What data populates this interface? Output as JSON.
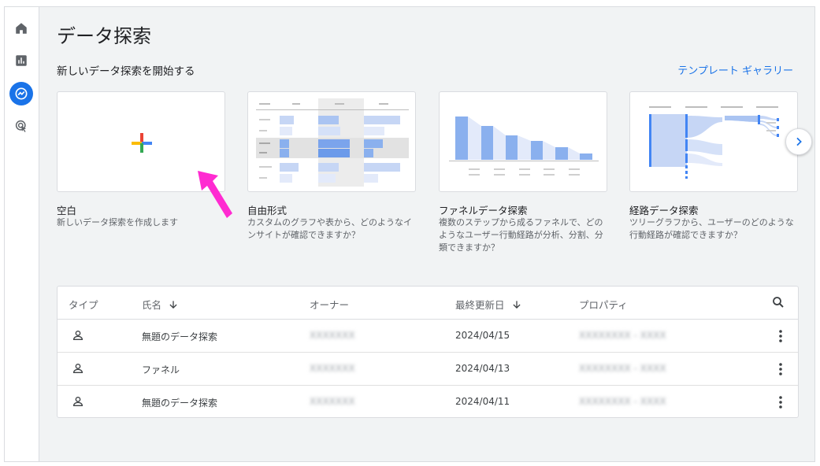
{
  "page_title": "データ探索",
  "section_title": "新しいデータ探索を開始する",
  "gallery_link": "テンプレート ギャラリー",
  "cards": [
    {
      "title": "空白",
      "desc": "新しいデータ探索を作成します"
    },
    {
      "title": "自由形式",
      "desc": "カスタムのグラフや表から、どのようなインサイトが確認できますか？"
    },
    {
      "title": "ファネルデータ探索",
      "desc": "複数のステップから成るファネルで、どのようなユーザー行動経路が分析、分割、分類できますか？"
    },
    {
      "title": "経路データ探索",
      "desc": "ツリーグラフから、ユーザーのどのような行動経路が確認できますか？"
    }
  ],
  "table": {
    "headers": {
      "type": "タイプ",
      "name": "氏名",
      "owner": "オーナー",
      "updated": "最終更新日",
      "property": "プロパティ"
    },
    "rows": [
      {
        "name": "無題のデータ探索",
        "owner": "XXXXXXX",
        "updated": "2024/04/15",
        "property": "XXXXXXXX - XXXX"
      },
      {
        "name": "ファネル",
        "owner": "XXXXXXX",
        "updated": "2024/04/13",
        "property": "XXXXXXXX - XXXX"
      },
      {
        "name": "無題のデータ探索",
        "owner": "XXXXXXX",
        "updated": "2024/04/11",
        "property": "XXXXXXXX - XXXX"
      }
    ]
  },
  "icons": {
    "rail": [
      "home-icon",
      "reports-icon",
      "explore-icon",
      "advertising-icon"
    ],
    "next": "chevron-right-icon",
    "search": "search-icon",
    "row_type": "person-icon",
    "row_menu": "more-vert-icon",
    "sort": "arrow-down-icon"
  },
  "colors": {
    "accent": "#1a73e8",
    "annotation_arrow": "#ff2bd1"
  }
}
